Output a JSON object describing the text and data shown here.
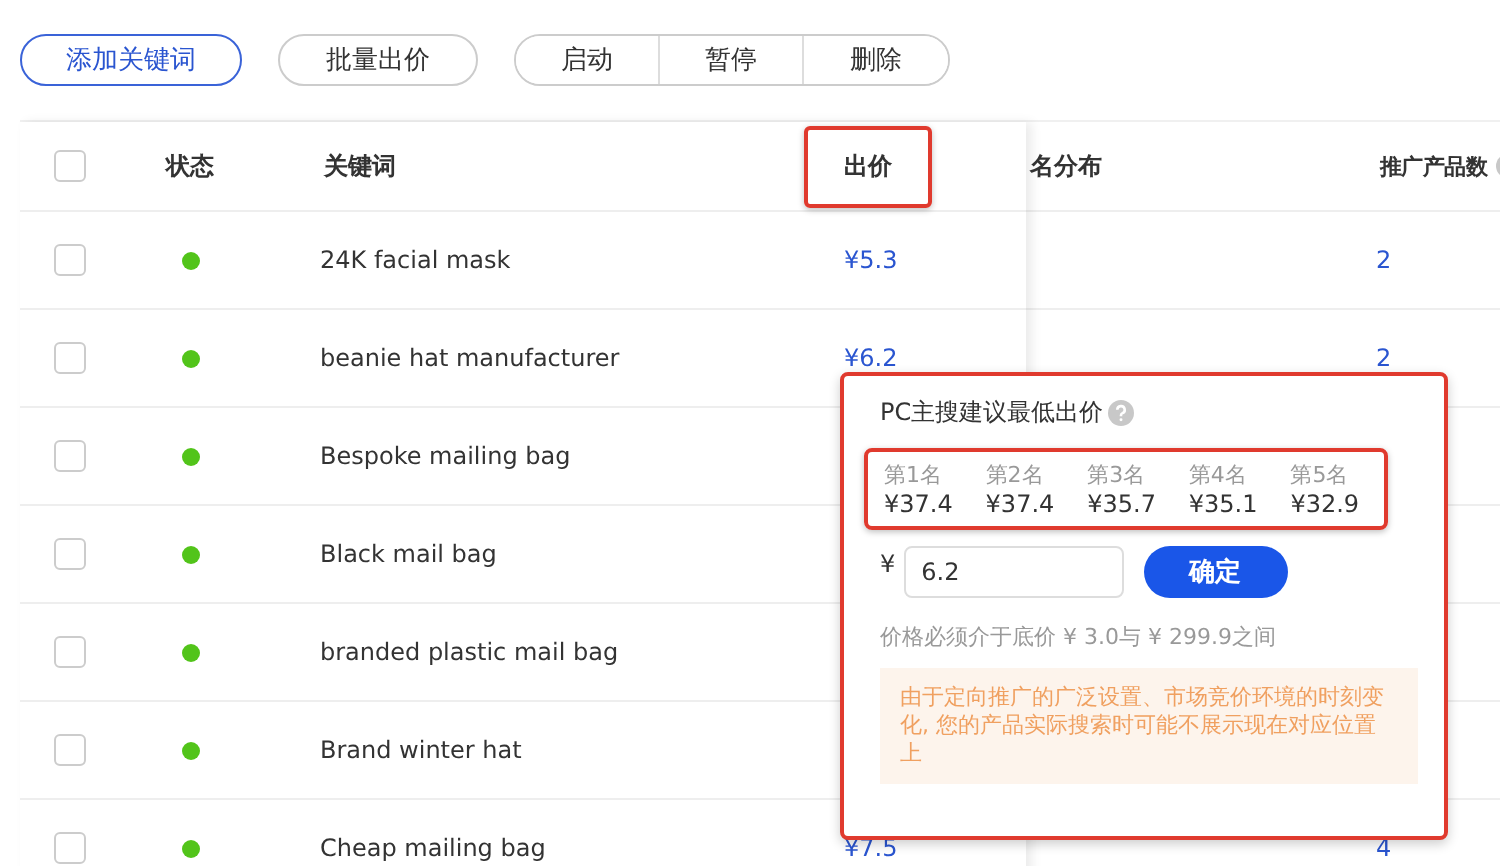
{
  "toolbar": {
    "buttons": [
      {
        "label": "添加关键词",
        "kind": "primary"
      },
      {
        "label": "批量出价",
        "kind": "default"
      }
    ],
    "group": [
      {
        "label": "启动"
      },
      {
        "label": "暂停"
      },
      {
        "label": "删除"
      }
    ]
  },
  "table": {
    "header_checked": false,
    "columns": [
      {
        "label": "状态",
        "highlighted": false
      },
      {
        "label": "关键词",
        "highlighted": false
      },
      {
        "label": "出价",
        "highlighted": true
      },
      {
        "label": "名分布",
        "highlighted": false
      },
      {
        "label": "推广产品数",
        "highlighted": false
      }
    ],
    "rows": [
      {
        "checked": false,
        "color": "#52c41a",
        "keyword": "24K facial mask",
        "price": "¥5.3",
        "products": "2"
      },
      {
        "checked": false,
        "color": "#52c41a",
        "keyword": "beanie hat manufacturer",
        "price": "¥6.2",
        "products": "2"
      },
      {
        "checked": false,
        "color": "#52c41a",
        "keyword": "Bespoke mailing bag"
      },
      {
        "checked": false,
        "color": "#52c41a",
        "keyword": "Black mail bag"
      },
      {
        "checked": false,
        "color": "#52c41a",
        "keyword": "branded plastic mail bag"
      },
      {
        "checked": false,
        "color": "#52c41a",
        "keyword": "Brand winter hat"
      },
      {
        "checked": false,
        "color": "#52c41a",
        "keyword": "Cheap mailing bag",
        "price": "¥7.5",
        "products": "4"
      }
    ]
  },
  "bid_popup": {
    "title": "PC主搜建议最低出价",
    "ranks_highlighted": true,
    "ranks": [
      {
        "label": "第1名",
        "price": "¥37.4"
      },
      {
        "label": "第2名",
        "price": "¥37.4"
      },
      {
        "label": "第3名",
        "price": "¥35.7"
      },
      {
        "label": "第4名",
        "price": "¥35.1"
      },
      {
        "label": "第5名",
        "price": "¥32.9"
      }
    ],
    "currency": "¥",
    "value": "6.2",
    "confirm": "确定",
    "hint": "价格必须介于底价 ¥ 3.0与 ¥ 299.9之间",
    "warning": "由于定向推广的广泛设置、市场竞价环境的时刻变化, 您的产品实际搜索时可能不展示现在对应位置上"
  }
}
